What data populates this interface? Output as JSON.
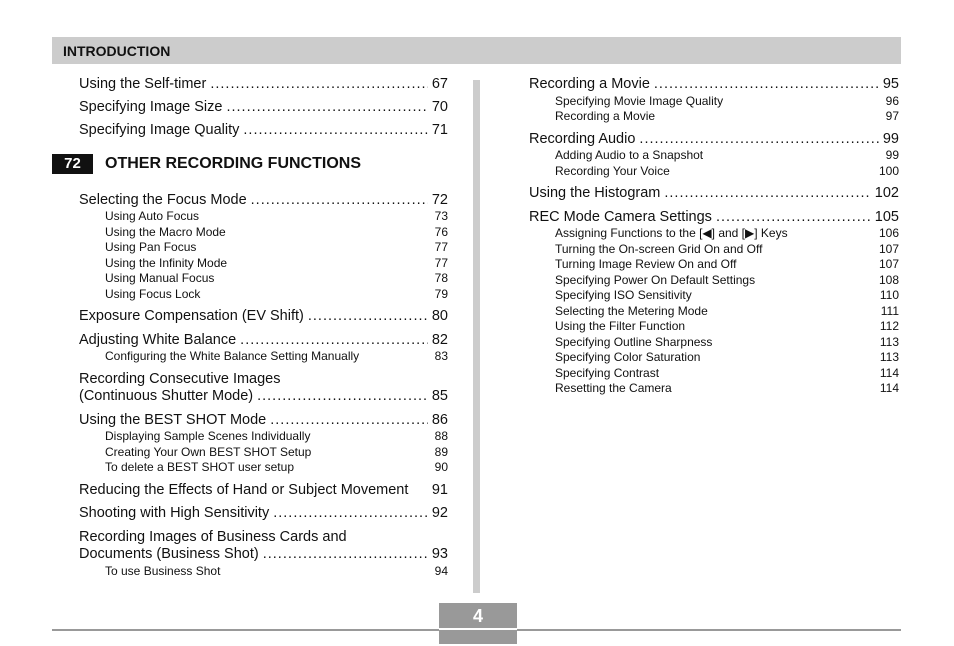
{
  "header": {
    "title": "INTRODUCTION"
  },
  "left": {
    "top_items": [
      {
        "title": "Using the Self-timer",
        "page": "67"
      },
      {
        "title": "Specifying Image Size",
        "page": "70"
      },
      {
        "title": "Specifying Image Quality",
        "page": "71"
      }
    ],
    "section": {
      "number": "72",
      "title": "OTHER RECORDING FUNCTIONS"
    },
    "groups": [
      {
        "title": "Selecting the Focus Mode",
        "page": "72",
        "subs": [
          {
            "title": "Using Auto Focus",
            "page": "73"
          },
          {
            "title": "Using the Macro Mode",
            "page": "76"
          },
          {
            "title": "Using Pan Focus",
            "page": "77"
          },
          {
            "title": "Using the Infinity Mode",
            "page": "77"
          },
          {
            "title": "Using Manual Focus",
            "page": "78"
          },
          {
            "title": "Using Focus Lock",
            "page": "79"
          }
        ]
      },
      {
        "title": "Exposure Compensation (EV Shift)",
        "page": "80",
        "subs": []
      },
      {
        "title": "Adjusting White Balance",
        "page": "82",
        "subs": [
          {
            "title": "Configuring the White Balance Setting Manually",
            "page": "83"
          }
        ]
      },
      {
        "title_line1": "Recording Consecutive Images",
        "title": "(Continuous Shutter Mode)",
        "page": "85",
        "subs": []
      },
      {
        "title": "Using the BEST SHOT Mode",
        "page": "86",
        "subs": [
          {
            "title": "Displaying Sample Scenes Individually",
            "page": "88"
          },
          {
            "title": "Creating Your Own BEST SHOT Setup",
            "page": "89"
          },
          {
            "title": "To delete a BEST SHOT user setup",
            "page": "90"
          }
        ]
      },
      {
        "title": "Reducing the Effects of Hand or Subject Movement",
        "page": "91",
        "subs": []
      },
      {
        "title": "Shooting with High Sensitivity",
        "page": "92",
        "subs": []
      },
      {
        "title_line1": "Recording Images of Business Cards and",
        "title": "Documents (Business Shot)",
        "page": "93",
        "subs": [
          {
            "title": "To use Business Shot",
            "page": "94"
          }
        ]
      }
    ]
  },
  "right": {
    "groups": [
      {
        "title": "Recording a Movie",
        "page": "95",
        "subs": [
          {
            "title": "Specifying Movie Image Quality",
            "page": "96"
          },
          {
            "title": "Recording a Movie",
            "page": "97"
          }
        ]
      },
      {
        "title": "Recording Audio",
        "page": "99",
        "subs": [
          {
            "title": "Adding Audio to a Snapshot",
            "page": "99"
          },
          {
            "title": "Recording Your Voice",
            "page": "100"
          }
        ]
      },
      {
        "title": "Using the Histogram",
        "page": "102",
        "subs": []
      },
      {
        "title": "REC Mode Camera Settings",
        "page": "105",
        "subs": [
          {
            "title": "Assigning Functions to the [◀] and [▶] Keys",
            "page": "106"
          },
          {
            "title": "Turning the On-screen Grid On and Off",
            "page": "107"
          },
          {
            "title": "Turning Image Review On and Off",
            "page": "107"
          },
          {
            "title": "Specifying Power On Default Settings",
            "page": "108"
          },
          {
            "title": "Specifying ISO Sensitivity",
            "page": "110"
          },
          {
            "title": "Selecting the Metering Mode",
            "page": "111"
          },
          {
            "title": "Using the Filter Function",
            "page": "112"
          },
          {
            "title": "Specifying Outline Sharpness",
            "page": "113"
          },
          {
            "title": "Specifying Color Saturation",
            "page": "113"
          },
          {
            "title": "Specifying Contrast",
            "page": "114"
          },
          {
            "title": "Resetting the Camera",
            "page": "114"
          }
        ]
      }
    ]
  },
  "footer": {
    "page_number": "4"
  }
}
